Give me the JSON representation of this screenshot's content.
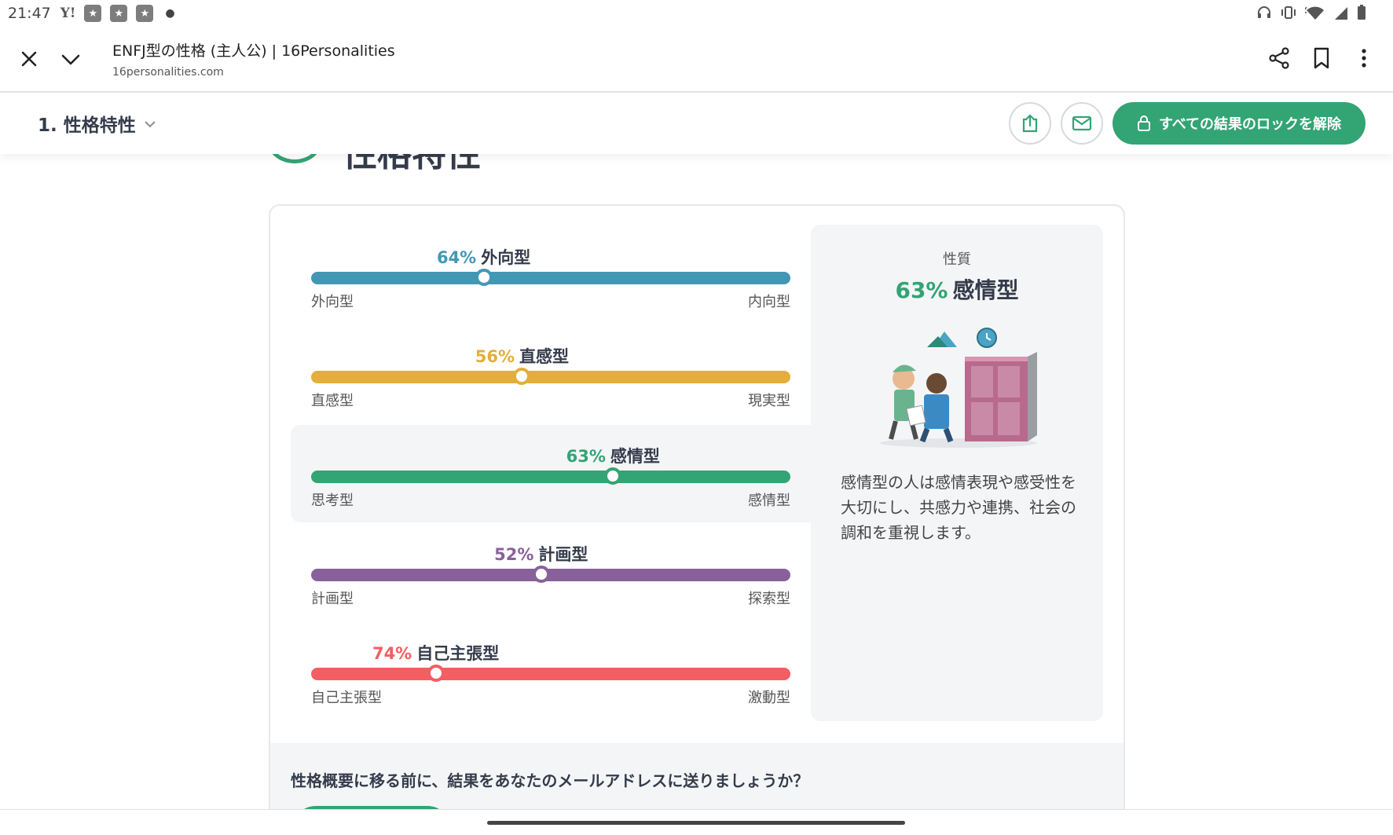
{
  "status_bar": {
    "time": "21:47",
    "carrier_icon": "Y!",
    "notif_icons": [
      "app-icon",
      "app-icon",
      "app-icon"
    ],
    "right_icons": [
      "headphones-icon",
      "vibrate-icon",
      "wifi-icon",
      "signal-icon",
      "battery-icon"
    ]
  },
  "browser": {
    "title": "ENFJ型の性格 (主人公) | 16Personalities",
    "url": "16personalities.com"
  },
  "section": {
    "title": "1. 性格特性",
    "unlock_label": "すべての結果のロックを解除",
    "peek_heading": "性格特性"
  },
  "traits": [
    {
      "percent": "64%",
      "name": "外向型",
      "left": "外向型",
      "right": "内向型",
      "value": 0.36,
      "color": "#4298b4"
    },
    {
      "percent": "56%",
      "name": "直感型",
      "left": "直感型",
      "right": "現実型",
      "value": 0.44,
      "color": "#e4ae3a"
    },
    {
      "percent": "63%",
      "name": "感情型",
      "left": "思考型",
      "right": "感情型",
      "value": 0.63,
      "color": "#33a474"
    },
    {
      "percent": "52%",
      "name": "計画型",
      "left": "計画型",
      "right": "探索型",
      "value": 0.48,
      "color": "#88619a"
    },
    {
      "percent": "74%",
      "name": "自己主張型",
      "left": "自己主張型",
      "right": "激動型",
      "value": 0.26,
      "color": "#f25e62"
    }
  ],
  "side_panel": {
    "label": "性質",
    "percent": "63%",
    "name": "感情型",
    "description": "感情型の人は感情表現や感受性を大切にし、共感力や連携、社会の調和を重視します。"
  },
  "footer": {
    "question": "性格概要に移る前に、結果をあなたのメールアドレスに送りましょうか？"
  }
}
